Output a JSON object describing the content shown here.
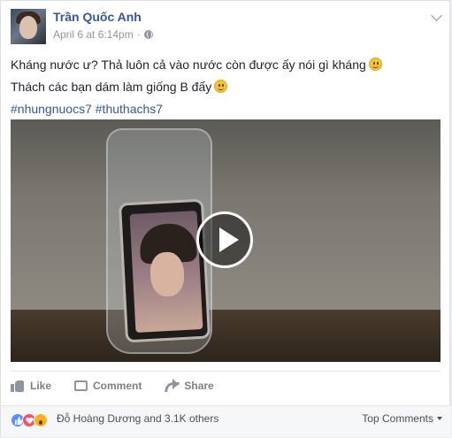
{
  "post": {
    "author": "Trần Quốc Anh",
    "timestamp": "April 6 at 6:14pm",
    "separator": "·",
    "privacy_icon": "globe-icon",
    "options_icon": "chevron-down-icon",
    "text_line1": "Kháng nước ư? Thả luôn cả vào nước còn được ấy nói gì kháng",
    "text_line2": "Thách các bạn dám làm giống B đấy",
    "hashtag1": "#nhungnuocs7",
    "hashtag2": "#thuthachs7",
    "video_icon": "play-icon"
  },
  "actions": {
    "like_label": "Like",
    "comment_label": "Comment",
    "share_label": "Share"
  },
  "reactions": {
    "icons": [
      "like-reaction-icon",
      "love-reaction-icon",
      "wow-reaction-icon"
    ],
    "summary": "Đỗ Hoàng Dương and 3.1K others",
    "sort_label": "Top Comments"
  },
  "colors": {
    "link_blue": "#365899",
    "like_blue": "#5890ff",
    "love_red": "#f25268",
    "wow_yellow": "#f7b125"
  }
}
